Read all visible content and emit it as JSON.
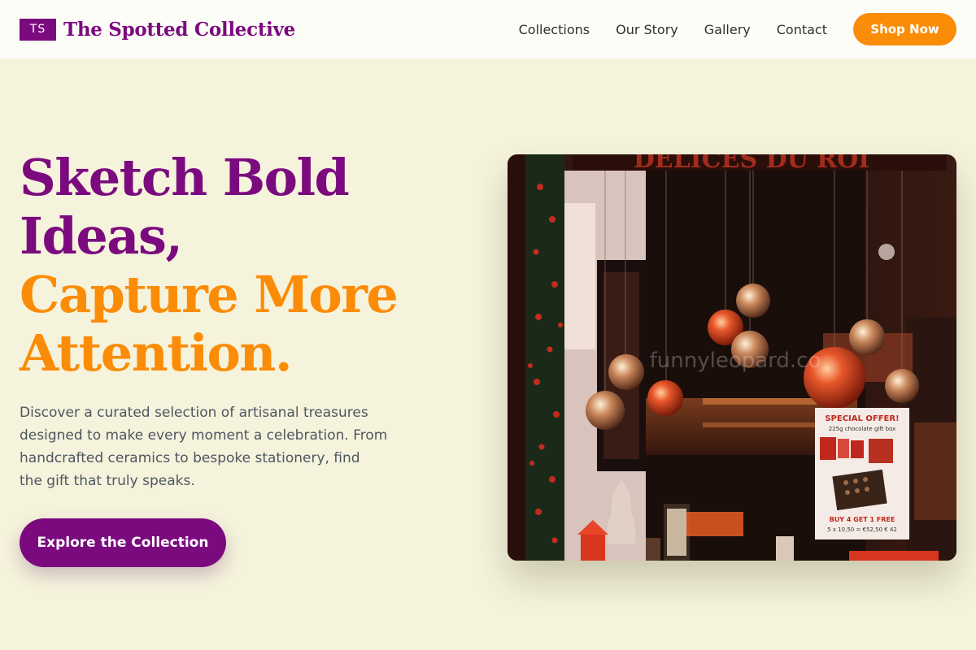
{
  "header": {
    "logo_initials": "TS",
    "brand_name": "The Spotted Collective",
    "nav": [
      "Collections",
      "Our Story",
      "Gallery",
      "Contact"
    ],
    "cta_label": "Shop Now"
  },
  "hero": {
    "title_line1": "Sketch Bold",
    "title_line2": "Ideas,",
    "title_line3": "Capture More",
    "title_line4": "Attention.",
    "description_lines": [
      "Discover a curated selection of artisanal treasures",
      "designed to make every moment a celebration. From",
      "handcrafted ceramics to bespoke stationery, find",
      "the gift that truly speaks."
    ],
    "button_label": "Explore the Collection"
  },
  "image": {
    "sign_text": "DELICES DU ROI",
    "watermark": "funnyleopard.co",
    "poster_title": "SPECIAL OFFER!",
    "poster_subtitle": "225g chocolate gift box",
    "poster_offer": "BUY 4 GET 1 FREE",
    "poster_price": "5 x 10,50 = €52,50  € 42"
  },
  "colors": {
    "brand_purple": "#7b0a7f",
    "accent_orange": "#fb8c07",
    "page_background": "#f5f3dc",
    "nav_background": "#fdfdf8"
  }
}
